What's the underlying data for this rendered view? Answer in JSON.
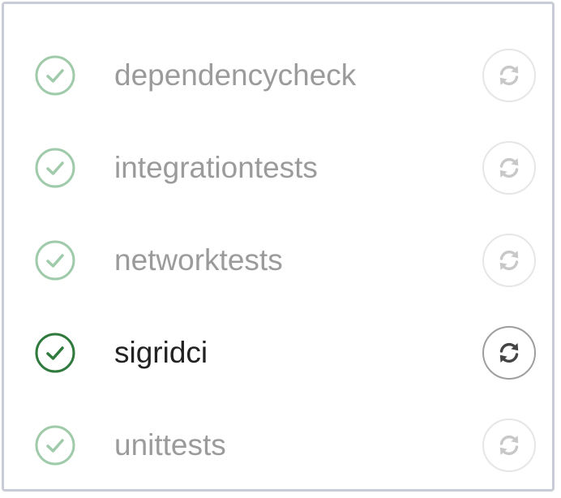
{
  "checks": [
    {
      "name": "dependencycheck",
      "status_icon": "check-circle-icon",
      "rerun_icon": "refresh-icon"
    },
    {
      "name": "integrationtests",
      "status_icon": "check-circle-icon",
      "rerun_icon": "refresh-icon"
    },
    {
      "name": "networktests",
      "status_icon": "check-circle-icon",
      "rerun_icon": "refresh-icon"
    },
    {
      "name": "sigridci",
      "status_icon": "check-circle-icon",
      "rerun_icon": "refresh-icon"
    },
    {
      "name": "unittests",
      "status_icon": "check-circle-icon",
      "rerun_icon": "refresh-icon"
    }
  ],
  "colors": {
    "success_faded": "#9fcbaa",
    "success_active": "#2f7a3c",
    "text_faded": "#9b9b9b",
    "text_active": "#222222",
    "icon_faded": "#c8c8c8",
    "icon_active": "#444444",
    "panel_border": "#c9ccd6"
  }
}
